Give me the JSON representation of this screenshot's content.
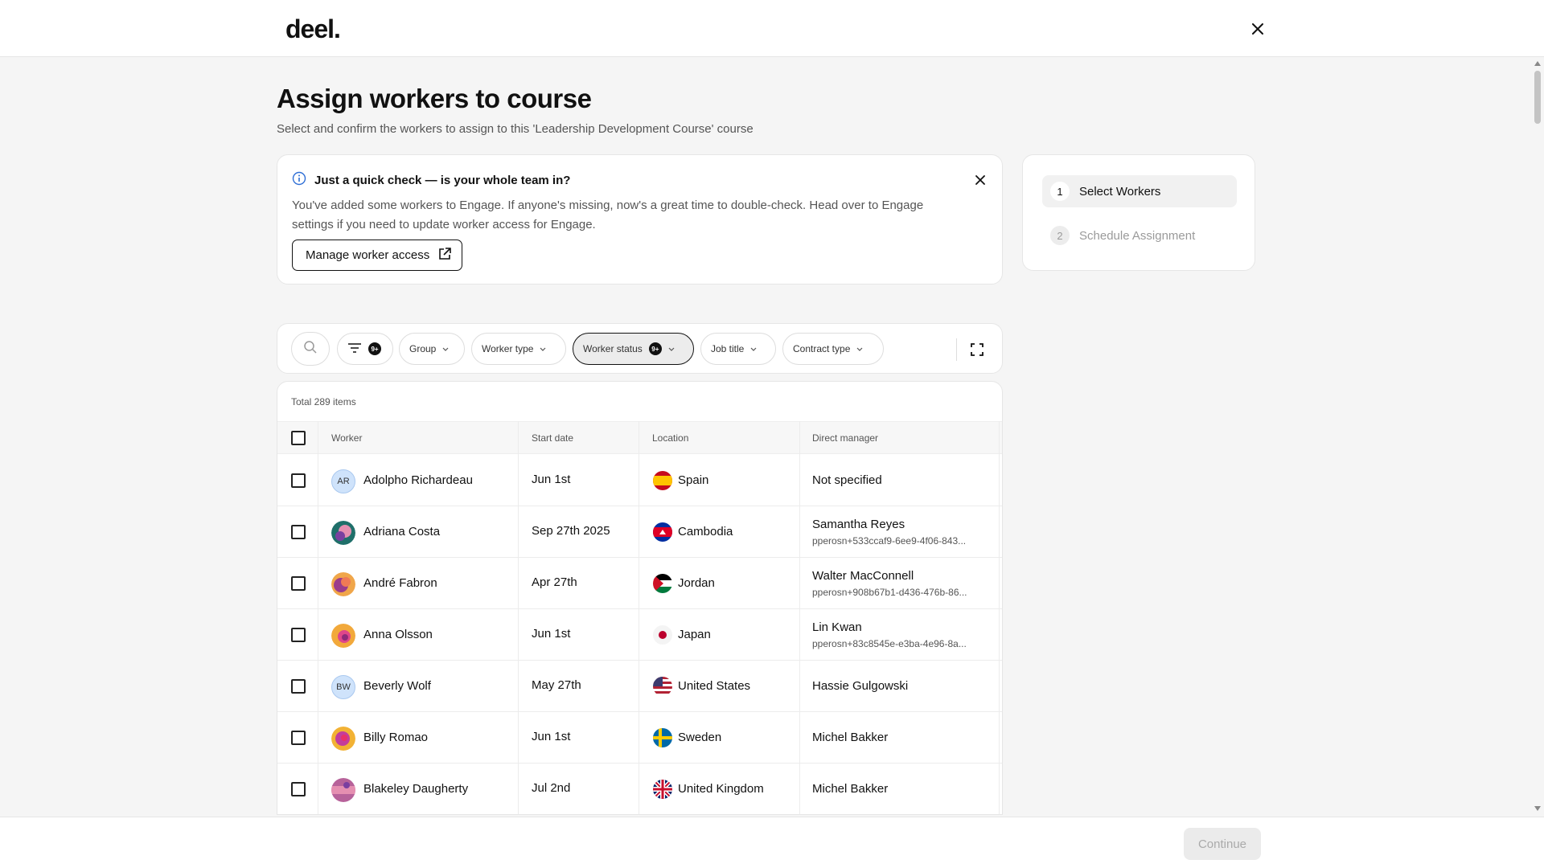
{
  "header": {
    "logo": "deel.",
    "close_icon": "close-icon"
  },
  "page": {
    "title": "Assign workers to course",
    "subtitle": "Select and confirm the workers to assign to this 'Leadership Development Course' course"
  },
  "banner": {
    "title": "Just a quick check — is your whole team in?",
    "text": "You've added some workers to Engage. If anyone's missing, now's a great time to double-check. Head over to Engage settings if you need to update worker access for Engage.",
    "button_label": "Manage worker access",
    "info_icon": "info-icon",
    "external_icon": "external-link-icon"
  },
  "stepper": {
    "steps": [
      {
        "num": "1",
        "label": "Select Workers"
      },
      {
        "num": "2",
        "label": "Schedule Assignment"
      }
    ]
  },
  "filters": {
    "filter_badge": "9+",
    "group": "Group",
    "worker_type": "Worker type",
    "worker_status": "Worker status",
    "worker_status_badge": "9+",
    "job_title": "Job title",
    "contract_type": "Contract type"
  },
  "table": {
    "total": "Total 289 items",
    "columns": [
      "Worker",
      "Start date",
      "Location",
      "Direct manager"
    ],
    "rows": [
      {
        "initials": "AR",
        "name": "Adolpho Richardeau",
        "start": "Jun 1st",
        "location": "Spain",
        "manager": "Not specified",
        "email": ""
      },
      {
        "initials": "",
        "name": "Adriana Costa",
        "start": "Sep 27th 2025",
        "location": "Cambodia",
        "manager": "Samantha Reyes",
        "email": "pperosn+533ccaf9-6ee9-4f06-843..."
      },
      {
        "initials": "",
        "name": "André Fabron",
        "start": "Apr 27th",
        "location": "Jordan",
        "manager": "Walter MacConnell",
        "email": "pperosn+908b67b1-d436-476b-86..."
      },
      {
        "initials": "",
        "name": "Anna Olsson",
        "start": "Jun 1st",
        "location": "Japan",
        "manager": "Lin Kwan",
        "email": "pperosn+83c8545e-e3ba-4e96-8a..."
      },
      {
        "initials": "BW",
        "name": "Beverly Wolf",
        "start": "May 27th",
        "location": "United States",
        "manager": "Hassie Gulgowski",
        "email": ""
      },
      {
        "initials": "",
        "name": "Billy Romao",
        "start": "Jun 1st",
        "location": "Sweden",
        "manager": "Michel Bakker",
        "email": ""
      },
      {
        "initials": "",
        "name": "Blakeley Daugherty",
        "start": "Jul 2nd",
        "location": "United Kingdom",
        "manager": "Michel Bakker",
        "email": ""
      }
    ]
  },
  "footer": {
    "continue_label": "Continue"
  }
}
